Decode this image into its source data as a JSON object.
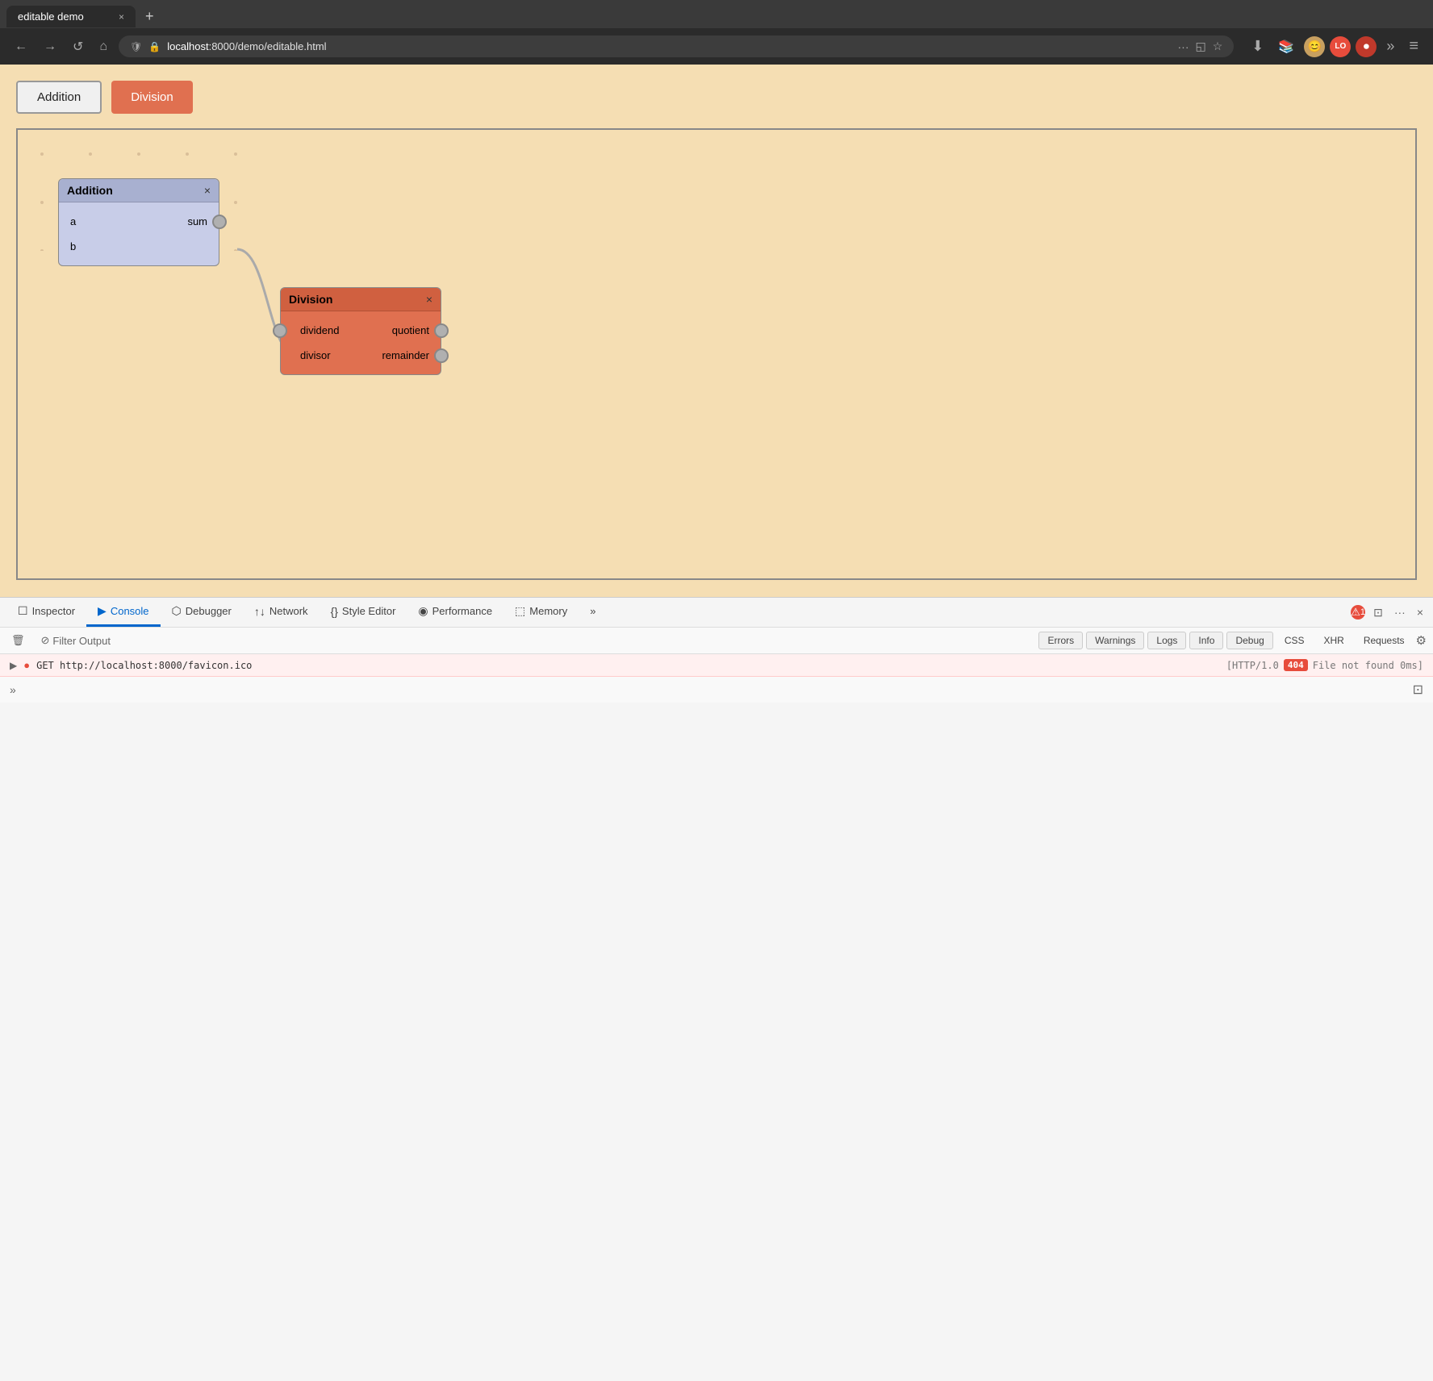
{
  "browser": {
    "tab_title": "editable demo",
    "tab_close": "×",
    "tab_new": "+",
    "nav": {
      "back": "←",
      "forward": "→",
      "reload": "↺",
      "home": "⌂"
    },
    "address": {
      "protocol": "localhost",
      "full": "localhost:8000/demo/editable.html",
      "shield": "🛡",
      "lock": "🔒"
    },
    "more_btn": "···",
    "overflow": "»",
    "menu": "≡",
    "bookmark_icon": "☆",
    "download_icon": "⬇"
  },
  "page": {
    "background": "#f5deb3",
    "buttons": [
      {
        "label": "Addition",
        "style": "outline"
      },
      {
        "label": "Division",
        "style": "filled"
      }
    ]
  },
  "canvas": {
    "nodes": [
      {
        "id": "addition",
        "title": "Addition",
        "color": "#c8cde8",
        "header_color": "#a8b0d0",
        "ports_left": [
          "a",
          "b"
        ],
        "ports_right": [
          "sum"
        ]
      },
      {
        "id": "division",
        "title": "Division",
        "color": "#e07050",
        "header_color": "#d06040",
        "ports_left": [
          "dividend",
          "divisor"
        ],
        "ports_right": [
          "quotient",
          "remainder"
        ]
      }
    ]
  },
  "devtools": {
    "tabs": [
      {
        "label": "Inspector",
        "icon": "☐",
        "active": false
      },
      {
        "label": "Console",
        "icon": "▶",
        "active": true
      },
      {
        "label": "Debugger",
        "icon": "⬡",
        "active": false
      },
      {
        "label": "Network",
        "icon": "↑↓",
        "active": false
      },
      {
        "label": "Style Editor",
        "icon": "{}",
        "active": false
      },
      {
        "label": "Performance",
        "icon": "◉",
        "active": false
      },
      {
        "label": "Memory",
        "icon": "⬚",
        "active": false
      }
    ],
    "overflow": "»",
    "error_count": "1",
    "right_btns": [
      "⊡",
      "···",
      "×"
    ],
    "console_bar": {
      "clear_btn": "🗑",
      "filter_placeholder": "Filter Output",
      "filter_icon": "⊘",
      "filter_btns": [
        {
          "label": "Errors",
          "active": false
        },
        {
          "label": "Warnings",
          "active": false
        },
        {
          "label": "Logs",
          "active": false
        },
        {
          "label": "Info",
          "active": false
        },
        {
          "label": "Debug",
          "active": false
        }
      ],
      "css_btn": "CSS",
      "xhr_btn": "XHR",
      "requests_btn": "Requests",
      "gear_icon": "⚙"
    },
    "log_row": {
      "expand_icon": "▶",
      "error_icon": "●",
      "text": "GET http://localhost:8000/favicon.ico",
      "meta": "[HTTP/1.0",
      "status_code": "404",
      "status_text": "File not found 0ms]"
    },
    "bottom": {
      "chevron": "»",
      "split_icon": "⊡"
    }
  }
}
